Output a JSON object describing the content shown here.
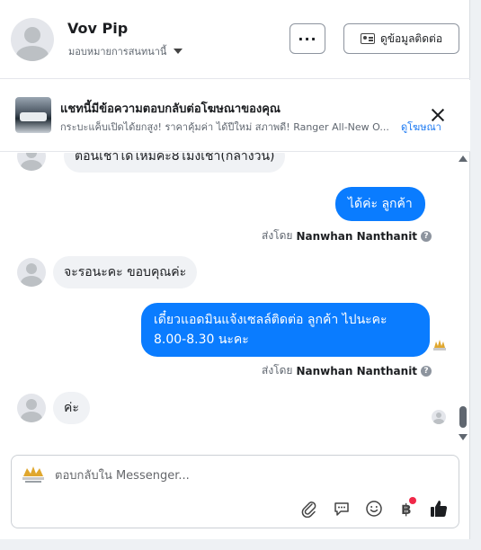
{
  "header": {
    "contact_name": "Vov Pip",
    "label": "มอบหมายการสนทนานี้",
    "more_label": "···",
    "contact_info_label": "ดูข้อมูลติดต่อ"
  },
  "ad_banner": {
    "title": "แชทนี้มีข้อความตอบกลับต่อโฆษณาของคุณ",
    "body": "กระบะแค็บเปิดได้ยกสูง! ราคาคุ้มค่า ได้ปีใหม่ สภาพดี! Ranger All-New O...",
    "link": "ดูโฆษณา",
    "thumb_text": "มีรถพร้อม"
  },
  "messages": [
    {
      "direction": "in",
      "text": "ตอนเช้าได้ไหมคะ8โมงเช้า(กลางวัน)"
    },
    {
      "direction": "out",
      "text": "ได้ค่ะ ลูกค้า",
      "sent_by_prefix": "ส่งโดย",
      "sent_by": "Nanwhan Nanthanit"
    },
    {
      "direction": "in",
      "text": "จะรอนะคะ ขอบคุณค่ะ"
    },
    {
      "direction": "out",
      "text": "เดี๋ยวแอดมินแจ้งเซลล์ติดต่อ ลูกค้า ไปนะคะ 8.00-8.30 นะคะ",
      "sent_by_prefix": "ส่งโดย",
      "sent_by": "Nanwhan Nanthanit"
    },
    {
      "direction": "in",
      "text": "ค่ะ"
    }
  ],
  "composer": {
    "placeholder": "ตอบกลับใน Messenger...",
    "tools": [
      "attach-icon",
      "saved-reply-icon",
      "emoji-icon",
      "payment-icon",
      "like-icon"
    ],
    "payment_symbol": "฿"
  },
  "colors": {
    "outgoing_bubble": "#0a7cff",
    "incoming_bubble": "#f0f2f5",
    "link": "#1877f2",
    "notification_dot": "#f02849"
  }
}
